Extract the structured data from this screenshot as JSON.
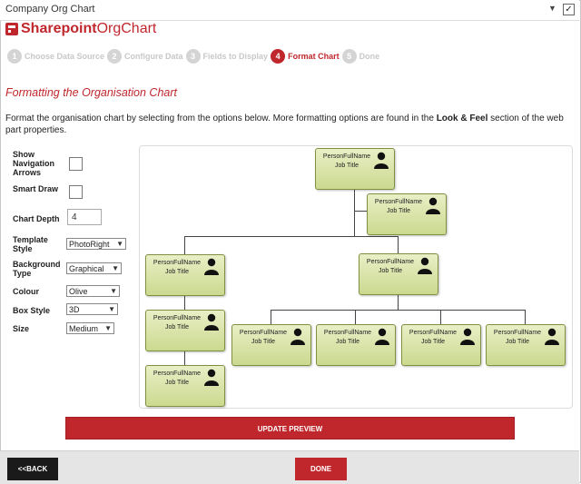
{
  "window": {
    "title": "Company Org Chart",
    "checkbox_mark": "✓"
  },
  "logo": {
    "bold": "Sharepoint",
    "light": "OrgChart"
  },
  "steps": [
    {
      "num": "1",
      "label": "Choose Data Source"
    },
    {
      "num": "2",
      "label": "Configure Data"
    },
    {
      "num": "3",
      "label": "Fields to Display"
    },
    {
      "num": "4",
      "label": "Format Chart"
    },
    {
      "num": "5",
      "label": "Done"
    }
  ],
  "heading": "Formatting the Organisation Chart",
  "desc": {
    "part1": "Format the organisation chart by selecting from the options below. More formatting options are found in the ",
    "bold": "Look & Feel",
    "part2": " section of the web part properties."
  },
  "options": {
    "nav_arrows_label": "Show Navigation Arrows",
    "smart_draw_label": "Smart Draw",
    "chart_depth_label": "Chart Depth",
    "chart_depth_value": "4",
    "template_label": "Template Style",
    "template_value": "PhotoRight",
    "background_label": "Background Type",
    "background_value": "Graphical",
    "colour_label": "Colour",
    "colour_value": "Olive",
    "box_style_label": "Box Style",
    "box_style_value": "3D",
    "size_label": "Size",
    "size_value": "Medium"
  },
  "node": {
    "name": "PersonFullName",
    "title": "Job Title"
  },
  "buttons": {
    "update": "UPDATE PREVIEW",
    "back": "<<BACK",
    "done": "DONE"
  },
  "colors": {
    "accent": "#c0272d",
    "node_fill": "#cbd98f",
    "node_border": "#7f9140"
  }
}
